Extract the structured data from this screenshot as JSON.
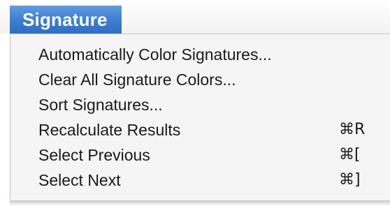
{
  "menu": {
    "title": "Signature",
    "items": [
      {
        "label": "Automatically Color Signatures...",
        "shortcut": ""
      },
      {
        "label": "Clear All Signature Colors...",
        "shortcut": ""
      },
      {
        "label": "Sort Signatures...",
        "shortcut": ""
      },
      {
        "label": "Recalculate Results",
        "shortcut": "⌘R"
      },
      {
        "label": "Select Previous",
        "shortcut": "⌘["
      },
      {
        "label": "Select Next",
        "shortcut": "⌘]"
      }
    ]
  },
  "colors": {
    "menu_title_bg": "#3d7fd2",
    "menu_title_text": "#ffffff",
    "panel_bg": "#f5f5f5",
    "item_text": "#1a1a1a"
  }
}
